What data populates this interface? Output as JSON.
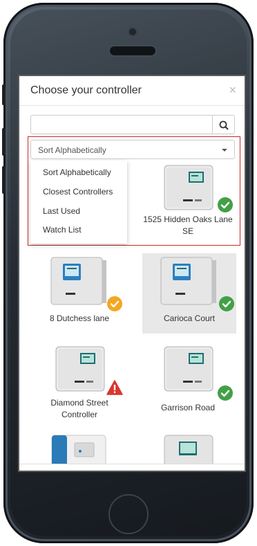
{
  "modal": {
    "title": "Choose your controller",
    "close_label": "×"
  },
  "search": {
    "placeholder": "",
    "value": ""
  },
  "sort": {
    "selected": "Sort Alphabetically",
    "options": [
      "Sort Alphabetically",
      "Closest Controllers",
      "Last Used",
      "Watch List"
    ]
  },
  "controllers": [
    {
      "name_line1": "1525 Hidden Oaks Lane",
      "name_line2": "SE",
      "status": "ok",
      "model": "PRO-HC",
      "selected": false
    },
    {
      "name_line1": "8 Dutchess lane",
      "name_line2": "",
      "status": "warning",
      "model": "HCC",
      "selected": false
    },
    {
      "name_line1": "Carioca Court",
      "name_line2": "",
      "status": "ok",
      "model": "HCC",
      "selected": true
    },
    {
      "name_line1": "Diamond Street",
      "name_line2": "Controller",
      "status": "alert",
      "model": "PRO-HC",
      "selected": false
    },
    {
      "name_line1": "Garrison Road",
      "name_line2": "",
      "status": "ok",
      "model": "PRO-HC",
      "selected": false
    },
    {
      "name_line1": "",
      "name_line2": "",
      "status": "",
      "model": "",
      "selected": false
    },
    {
      "name_line1": "",
      "name_line2": "",
      "status": "",
      "model": "",
      "selected": false
    }
  ],
  "colors": {
    "ok": "#43a047",
    "warning": "#f5a623",
    "alert": "#d9362f",
    "highlight_border": "#c62828"
  }
}
